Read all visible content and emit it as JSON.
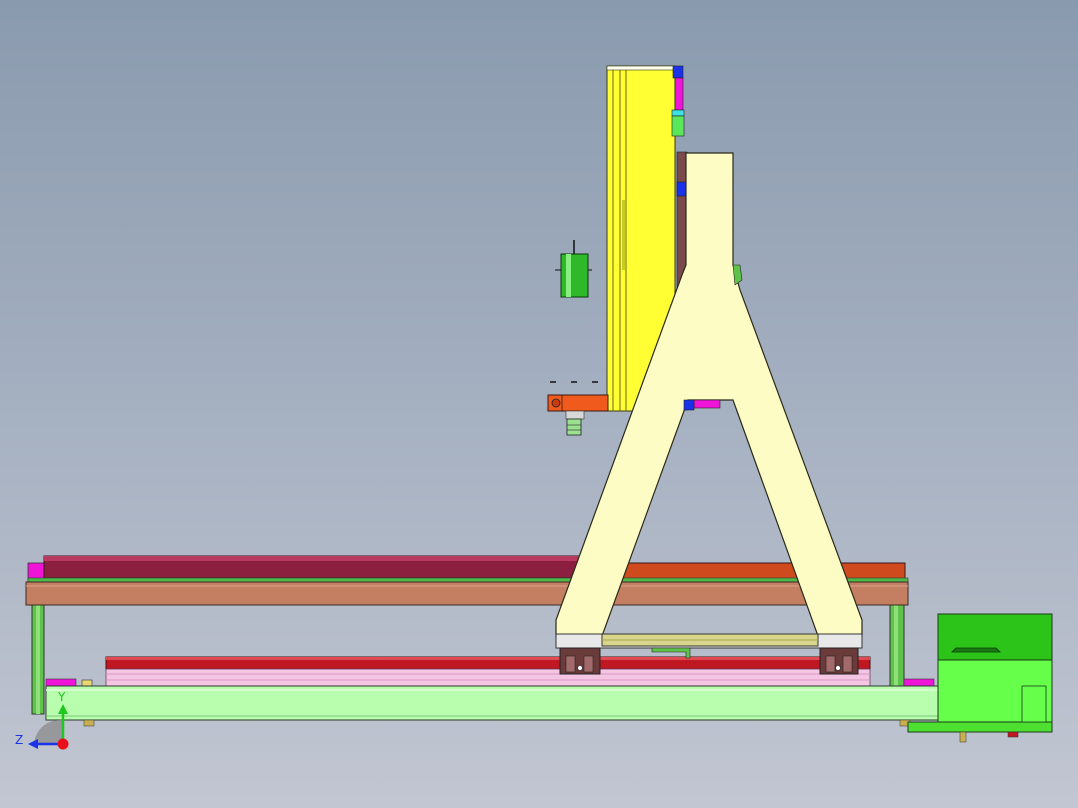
{
  "viewport": {
    "background_top": "#8a9aae",
    "background_bottom": "#c2c6d2"
  },
  "colors": {
    "gantry": "#fdfcc4",
    "z_axis_plate": "#ffff33",
    "rail_maroon": "#8c1f40",
    "rail_orange": "#cf4a1c",
    "table_frame": "#c47f63",
    "base_green": "#b9fdaf",
    "motor_green": "#2dc41a",
    "spindle_orange": "#f05a1c",
    "carriage_brown": "#6b3b3b",
    "accent_magenta": "#f014d8",
    "accent_blue": "#1a33e8"
  },
  "triad": {
    "y_label": "Y",
    "z_label": "Z"
  }
}
